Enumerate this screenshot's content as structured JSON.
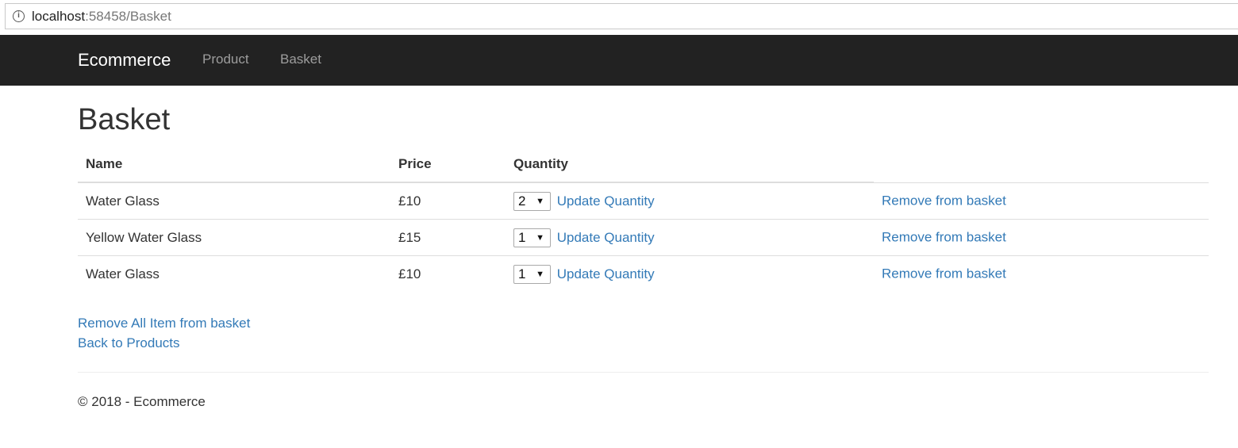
{
  "browser": {
    "url_host": "localhost",
    "url_path": ":58458/Basket",
    "info_icon": "info-icon"
  },
  "navbar": {
    "brand": "Ecommerce",
    "links": [
      "Product",
      "Basket"
    ]
  },
  "page": {
    "title": "Basket"
  },
  "table": {
    "headers": [
      "Name",
      "Price",
      "Quantity",
      ""
    ],
    "rows": [
      {
        "name": "Water Glass",
        "price": "£10",
        "quantity": "2",
        "update_label": "Update Quantity",
        "remove_label": "Remove from basket"
      },
      {
        "name": "Yellow Water Glass",
        "price": "£15",
        "quantity": "1",
        "update_label": "Update Quantity",
        "remove_label": "Remove from basket"
      },
      {
        "name": "Water Glass",
        "price": "£10",
        "quantity": "1",
        "update_label": "Update Quantity",
        "remove_label": "Remove from basket"
      }
    ]
  },
  "actions": {
    "remove_all": "Remove All Item from basket",
    "back": "Back to Products"
  },
  "footer": {
    "text": "© 2018 - Ecommerce"
  },
  "colors": {
    "navbar_bg": "#222222",
    "link": "#337ab7",
    "nav_link": "#9d9d9d",
    "text": "#333333"
  }
}
